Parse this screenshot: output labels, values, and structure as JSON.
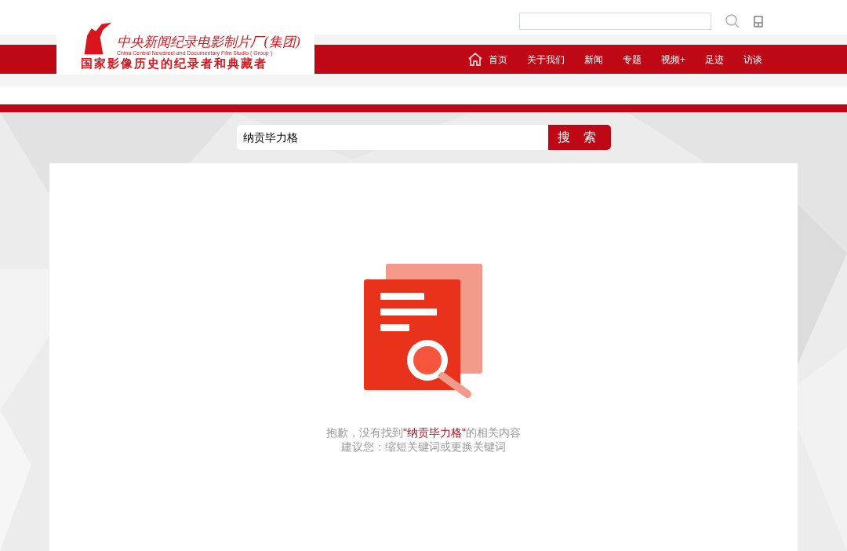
{
  "header": {
    "logo": {
      "title": "中央新闻纪录电影制片厂(集团)",
      "subtitle": "China Central Newsreel and Documentary Film Studio ( Group )",
      "slogan": "国家影像历史的纪录者和典藏者"
    }
  },
  "nav": [
    {
      "label": "首页",
      "kind": "home"
    },
    {
      "label": "关于我们",
      "kind": "link"
    },
    {
      "label": "新闻",
      "kind": "link"
    },
    {
      "label": "专题",
      "kind": "link"
    },
    {
      "label": "视频+",
      "kind": "link"
    },
    {
      "label": "足迹",
      "kind": "link"
    },
    {
      "label": "访谈",
      "kind": "link"
    }
  ],
  "search": {
    "value": "纳贡毕力格",
    "button": "搜 索"
  },
  "result": {
    "message_prefix": "抱歉，没有找到",
    "keyword": "\"纳贡毕力格\"",
    "message_suffix": "的相关内容",
    "suggestion": "建议您：缩短关键词或更换关键词"
  }
}
